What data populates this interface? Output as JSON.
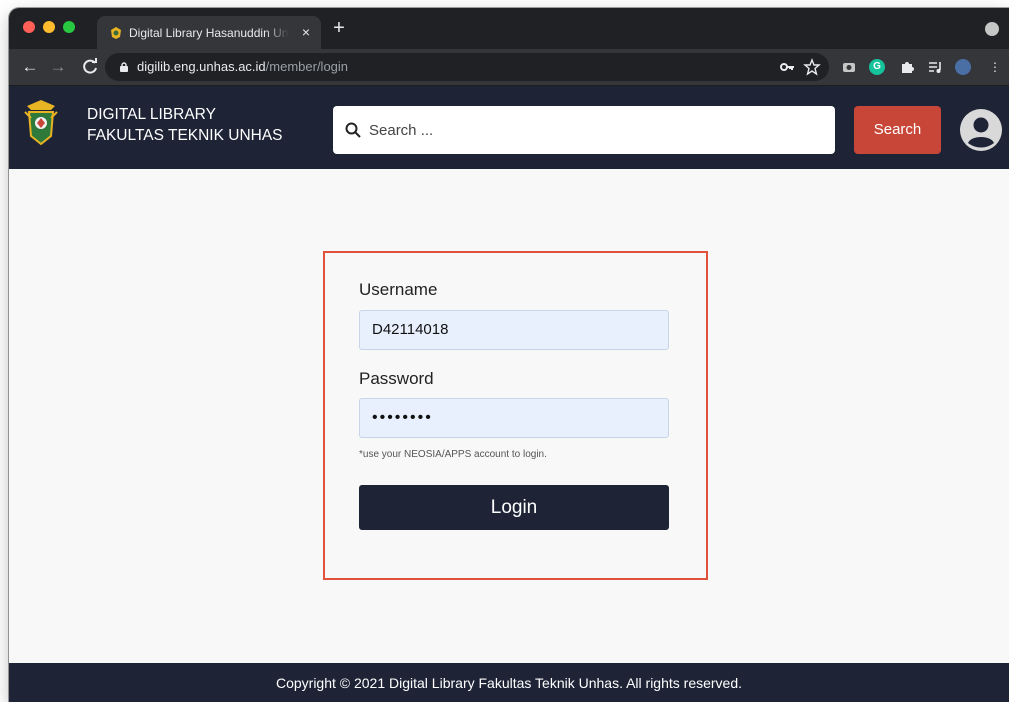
{
  "browser": {
    "tab": {
      "title": "Digital Library Hasanuddin University",
      "close": "×"
    },
    "new_tab": "+",
    "nav": {
      "back": "←",
      "forward": "→",
      "reload": "C"
    },
    "address": {
      "host": "digilib.eng.unhas.ac.id",
      "path": "/member/login"
    },
    "icons": {
      "key": "key-icon",
      "star": "star-icon",
      "camera": "camera-icon",
      "grammarly": "G",
      "puzzle": "puzzle-icon",
      "playlist": "playlist-icon",
      "menu": "⋮"
    }
  },
  "header": {
    "brand_line1": "DIGITAL LIBRARY",
    "brand_line2": "FAKULTAS TEKNIK UNHAS",
    "search_placeholder": "Search ...",
    "search_button": "Search"
  },
  "login": {
    "username_label": "Username",
    "username_value": "D42114018",
    "password_label": "Password",
    "password_value": "••••••••",
    "hint": "*use your NEOSIA/APPS account to login.",
    "login_button": "Login"
  },
  "footer": {
    "copyright": "Copyright © 2021 Digital Library Fakultas Teknik Unhas. All rights reserved."
  },
  "colors": {
    "header_bg": "#1e2336",
    "search_button_bg": "#c84638",
    "card_border": "#e2513c",
    "input_bg": "#e8f0fe"
  }
}
